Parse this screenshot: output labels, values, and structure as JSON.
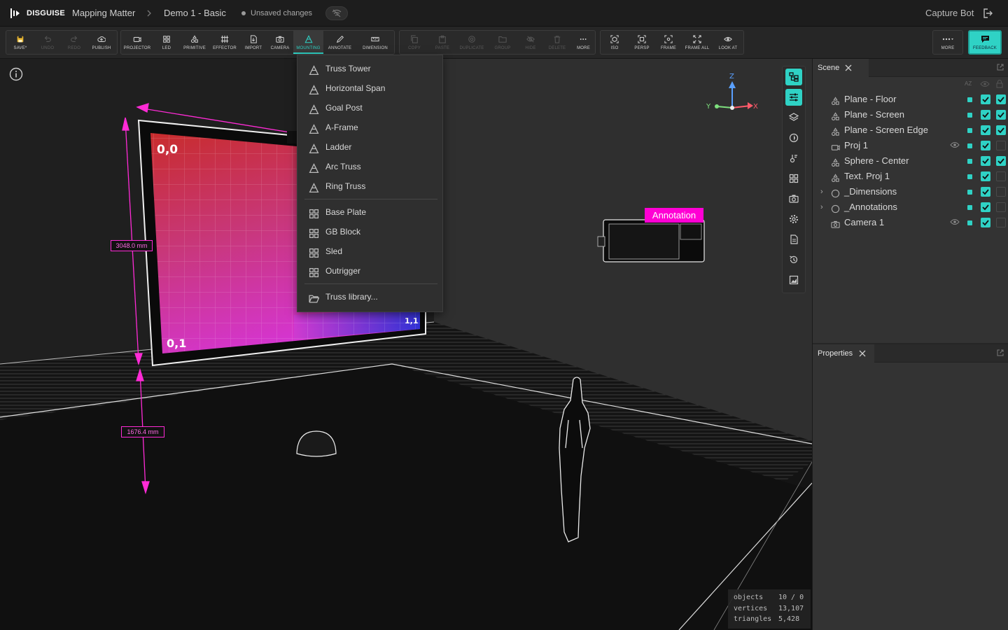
{
  "topbar": {
    "brand": "DISGUISE",
    "project": "Mapping Matter",
    "file": "Demo 1 - Basic",
    "status": "Unsaved changes",
    "user": "Capture Bot"
  },
  "toolbar": {
    "g1": [
      {
        "label": "SAVE*",
        "icon": "save-icon"
      },
      {
        "label": "UNDO",
        "icon": "undo-icon",
        "disabled": true
      },
      {
        "label": "REDO",
        "icon": "redo-icon",
        "disabled": true
      },
      {
        "label": "PUBLISH",
        "icon": "cloud-upload-icon"
      }
    ],
    "g2": [
      {
        "label": "PROJECTOR",
        "icon": "projector-icon"
      },
      {
        "label": "LED",
        "icon": "led-grid-icon"
      },
      {
        "label": "PRIMITIVE",
        "icon": "primitive-icon"
      },
      {
        "label": "EFFECTOR",
        "icon": "effector-icon"
      },
      {
        "label": "IMPORT",
        "icon": "import-icon"
      },
      {
        "label": "CAMERA",
        "icon": "camera-icon"
      },
      {
        "label": "MOUNTING",
        "icon": "truss-icon",
        "active": true
      },
      {
        "label": "ANNOTATE",
        "icon": "pen-icon"
      },
      {
        "label": "DIMENSION",
        "icon": "ruler-icon"
      }
    ],
    "g3": [
      {
        "label": "COPY",
        "icon": "copy-icon",
        "disabled": true
      },
      {
        "label": "PASTE",
        "icon": "paste-icon",
        "disabled": true
      },
      {
        "label": "DUPLICATE",
        "icon": "duplicate-icon",
        "disabled": true
      },
      {
        "label": "GROUP",
        "icon": "folder-icon",
        "disabled": true
      },
      {
        "label": "HIDE",
        "icon": "eye-off-icon",
        "disabled": true
      },
      {
        "label": "DELETE",
        "icon": "trash-icon",
        "disabled": true
      },
      {
        "label": "MORE",
        "icon": "more-icon"
      }
    ],
    "g4": [
      {
        "label": "ISO",
        "icon": "iso-icon"
      },
      {
        "label": "PERSP",
        "icon": "persp-icon"
      },
      {
        "label": "FRAME",
        "icon": "frame-icon"
      },
      {
        "label": "FRAME ALL",
        "icon": "frame-all-icon"
      },
      {
        "label": "LOOK AT",
        "icon": "look-at-icon"
      }
    ],
    "more_label": "MORE",
    "feedback_label": "FEEDBACK"
  },
  "mounting_menu": {
    "items": [
      "Truss Tower",
      "Horizontal Span",
      "Goal Post",
      "A-Frame",
      "Ladder",
      "Arc Truss",
      "Ring Truss",
      "Base Plate",
      "GB Block",
      "Sled",
      "Outrigger",
      "Truss library..."
    ]
  },
  "viewport": {
    "dim_height": "3048.0 mm",
    "dim_offset": "1676.4 mm",
    "annotation": "Annotation",
    "screen_labels": {
      "top_left": "0,0",
      "bottom_left": "0,1",
      "bottom_right": "1,1"
    },
    "axes": {
      "x": "X",
      "y": "Y",
      "z": "Z"
    },
    "colors": {
      "accent": "#2fd2c5",
      "dimension": "#ff2bd6",
      "annotation": "#ff00d4"
    }
  },
  "stats": {
    "rows": [
      {
        "key": "objects",
        "value": "10 / 0"
      },
      {
        "key": "vertices",
        "value": "13,107"
      },
      {
        "key": "triangles",
        "value": "5,428"
      }
    ]
  },
  "scene_panel": {
    "tab": "Scene",
    "sort_label": "AZ",
    "rows": [
      {
        "name": "Plane - Floor",
        "icon": "primitive-icon",
        "c1": true,
        "c2": true
      },
      {
        "name": "Plane - Screen",
        "icon": "primitive-icon",
        "c1": true,
        "c2": true
      },
      {
        "name": "Plane - Screen Edge",
        "icon": "primitive-icon",
        "c1": true,
        "c2": true
      },
      {
        "name": "Proj 1",
        "icon": "projector-icon",
        "c1": true,
        "c2": false,
        "eye": true
      },
      {
        "name": "Sphere - Center",
        "icon": "primitive-icon",
        "c1": true,
        "c2": true
      },
      {
        "name": "Text. Proj 1",
        "icon": "primitive-icon",
        "c1": true,
        "c2": false
      },
      {
        "name": "_Dimensions",
        "icon": "group-circle-icon",
        "c1": true,
        "c2": false,
        "expandable": true
      },
      {
        "name": "_Annotations",
        "icon": "group-circle-icon",
        "c1": true,
        "c2": false,
        "expandable": true
      },
      {
        "name": "Camera 1",
        "icon": "camera-icon",
        "c1": true,
        "c2": false,
        "eye": true
      }
    ]
  },
  "properties_panel": {
    "tab": "Properties"
  }
}
